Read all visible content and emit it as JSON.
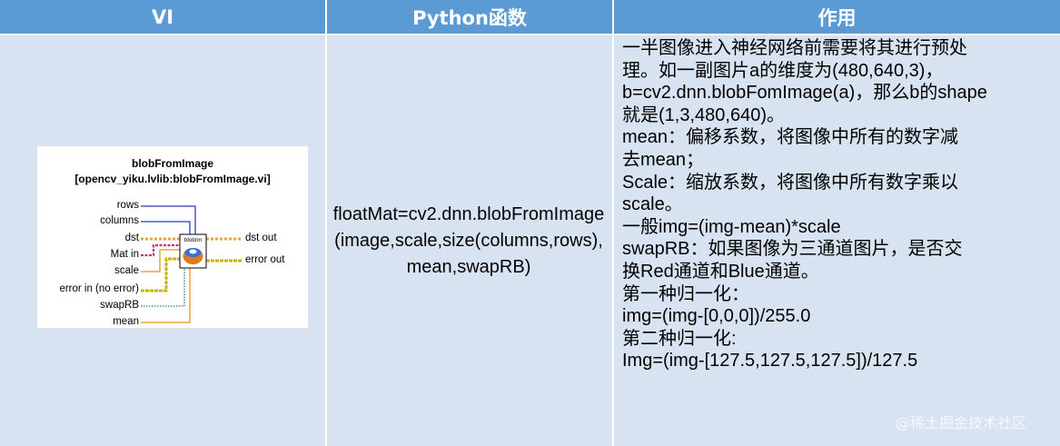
{
  "header": {
    "col_vi": "VI",
    "col_python": "Python函数",
    "col_use": "作用"
  },
  "vi": {
    "title_line1": "blobFromImage",
    "title_line2": "[opencv_yiku.lvlib:blobFromImage.vi]",
    "icon_label": "blobIm",
    "inputs": [
      "rows",
      "columns",
      "dst",
      "Mat in",
      "scale",
      "error in (no error)",
      "swapRB",
      "mean"
    ],
    "outputs": [
      "dst out",
      "error out"
    ]
  },
  "python": {
    "code": "floatMat=cv2.dnn.blobFromImage(image,scale,size(columns,rows),mean,swapRB)"
  },
  "use": {
    "lines": [
      "一半图像进入神经网络前需要将其进行预处",
      "理。如一副图片a的维度为(480,640,3)，",
      "b=cv2.dnn.blobFomImage(a)，那么b的shape",
      "就是(1,3,480,640)。",
      "mean：偏移系数，将图像中所有的数字减",
      "去mean；",
      "Scale：缩放系数，将图像中所有数字乘以",
      "scale。",
      "一般img=(img-mean)*scale",
      "swapRB：如果图像为三通道图片，是否交",
      "换Red通道和Blue通道。",
      "第一种归一化：",
      "img=(img-[0,0,0])/255.0",
      "第二种归一化:",
      "Img=(img-[127.5,127.5,127.5])/127.5"
    ]
  },
  "watermark": "@稀土掘金技术社区",
  "colors": {
    "header_bg": "#5b9bd5",
    "cell_bg": "#d7e3f1",
    "wire_orange": "#e8a33d",
    "wire_blue": "#2a3bb8",
    "wire_pink": "#d4207f",
    "wire_green": "#2e8b3a",
    "wire_yellow": "#c8b400"
  }
}
